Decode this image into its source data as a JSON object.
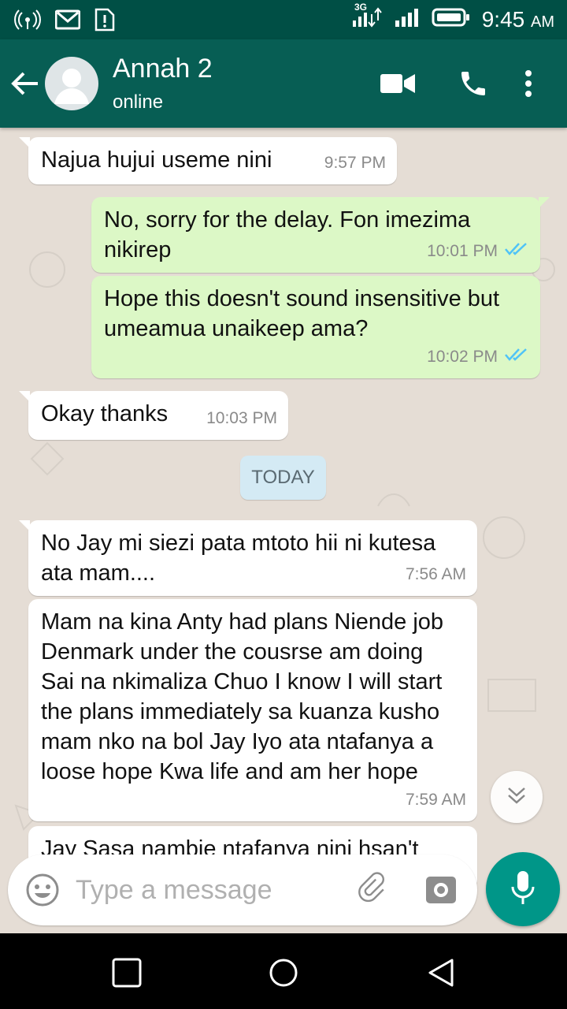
{
  "status_bar": {
    "network_label": "3G",
    "time": "9:45",
    "ampm": "AM"
  },
  "header": {
    "contact_name": "Annah 2",
    "contact_status": "online"
  },
  "messages": [
    {
      "dir": "in",
      "text": "Najua hujui useme nini",
      "time": "9:57 PM"
    },
    {
      "dir": "out",
      "text": "No,  sorry for the delay. Fon imezima nikirep",
      "time": "10:01 PM",
      "status": "read"
    },
    {
      "dir": "out",
      "text": "Hope this doesn't sound insensitive but umeamua unaikeep ama?",
      "time": "10:02 PM",
      "status": "read"
    },
    {
      "dir": "in",
      "text": "Okay thanks",
      "time": "10:03 PM"
    },
    {
      "dir": "in",
      "text": "No Jay mi siezi pata mtoto hii ni kutesa ata mam....",
      "time": "7:56 AM"
    },
    {
      "dir": "in",
      "text": "Mam na kina Anty had plans Niende job Denmark under the cousrse am doing Sai na nkimaliza Chuo I know I will start the plans immediately sa kuanza kusho mam nko na bol Jay Iyo ata ntafanya a loose hope Kwa life and am her hope",
      "time": "7:59 AM"
    },
    {
      "dir": "in",
      "text": "Jay Sasa nambie ntafanya nini hsan't",
      "time": ""
    }
  ],
  "date_divider": "TODAY",
  "composer": {
    "placeholder": "Type a message"
  },
  "colors": {
    "header": "#075e54",
    "status_bar": "#004f45",
    "outgoing_bubble": "#dcf8c6",
    "chat_bg": "#e5ddd5",
    "read_ticks": "#4fc3f7",
    "mic_button": "#009688"
  },
  "icons": [
    "back-arrow-icon",
    "video-call-icon",
    "phone-icon",
    "more-vert-icon",
    "emoji-icon",
    "attach-icon",
    "camera-icon",
    "mic-icon",
    "scroll-down-icon",
    "nav-recents-icon",
    "nav-home-icon",
    "nav-back-icon"
  ]
}
